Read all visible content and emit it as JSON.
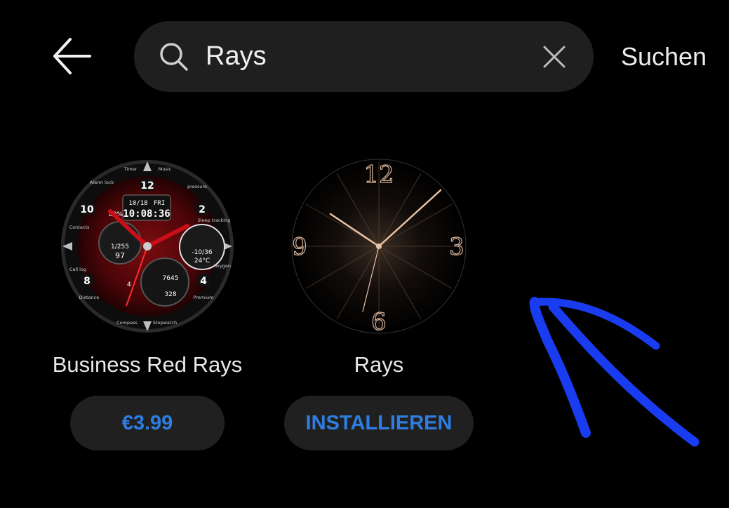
{
  "header": {
    "back_icon": "arrow-left-icon",
    "search": {
      "value": "Rays",
      "icon": "search-icon",
      "clear_icon": "close-icon"
    },
    "submit_label": "Suchen"
  },
  "results": [
    {
      "title": "Business Red Rays",
      "action_label": "€3.99",
      "face": {
        "date": "10/18",
        "day": "FRI",
        "time": "10:08:36",
        "battery": "80%",
        "heart": "1/255",
        "heart_value": "97",
        "weather_range": "-10/36",
        "temperature": "24°C",
        "steps": "7645",
        "calories": "328",
        "hour_12": "12",
        "hour_10": "10",
        "hour_2": "2",
        "hour_8": "8",
        "hour_4": "4",
        "hour_4_small": "4",
        "ring_timer": "Timer",
        "ring_music": "Music",
        "ring_alarm": "Alarm lock",
        "ring_pressure": "pressure",
        "ring_contacts": "Contacts",
        "ring_calllog": "Call log",
        "ring_distance": "Distance",
        "ring_compass": "Compass",
        "ring_stopwatch": "Stopwatch",
        "ring_sleep": "Sleep tracking",
        "ring_blood": "Blood oxygen",
        "ring_premium": "Premium"
      }
    },
    {
      "title": "Rays",
      "action_label": "INSTALLIEREN",
      "face": {
        "n12": "12",
        "n3": "3",
        "n6": "6",
        "n9": "9"
      }
    }
  ],
  "colors": {
    "background": "#000000",
    "surface": "#1f1f1f",
    "accent": "#2f7de1",
    "annotation": "#1a3cf0"
  }
}
